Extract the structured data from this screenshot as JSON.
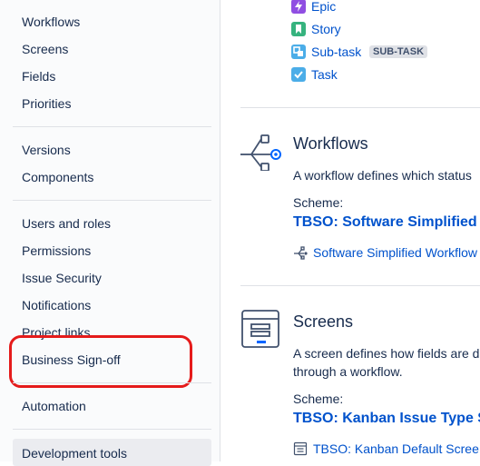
{
  "sidebar": {
    "groups": [
      [
        "Workflows",
        "Screens",
        "Fields",
        "Priorities"
      ],
      [
        "Versions",
        "Components"
      ],
      [
        "Users and roles",
        "Permissions",
        "Issue Security",
        "Notifications",
        "Project links",
        "Business Sign-off"
      ],
      [
        "Automation"
      ]
    ],
    "dev_tools": "Development tools",
    "highlight_color": "#e51b1b"
  },
  "issue_types": [
    {
      "label": "Epic",
      "icon": "epic-bolt-icon",
      "color": "#904ee2"
    },
    {
      "label": "Story",
      "icon": "story-bookmark-icon",
      "color": "#36b37e"
    },
    {
      "label": "Sub-task",
      "icon": "subtask-icon",
      "color": "#4bade8",
      "badge": "SUB-TASK"
    },
    {
      "label": "Task",
      "icon": "task-check-icon",
      "color": "#4bade8"
    }
  ],
  "workflows": {
    "title": "Workflows",
    "description": "A workflow defines which status",
    "scheme_label": "Scheme:",
    "scheme_name": "TBSO: Software Simplified",
    "item": "Software Simplified Workflow"
  },
  "screens": {
    "title": "Screens",
    "description_line1": "A screen defines how fields are d",
    "description_line2": "through a workflow.",
    "scheme_label": "Scheme:",
    "scheme_name": "TBSO: Kanban Issue Type S",
    "item": "TBSO: Kanban Default Scree"
  },
  "colors": {
    "link": "#0052cc",
    "text": "#172b4d",
    "accent_icon": "#0065ff"
  }
}
